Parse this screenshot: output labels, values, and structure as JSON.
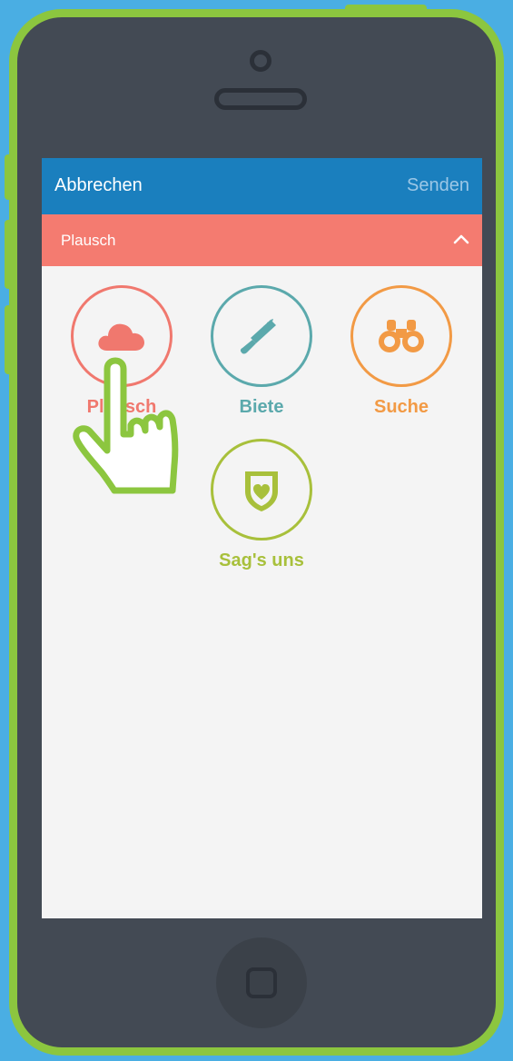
{
  "navbar": {
    "cancel_label": "Abbrechen",
    "send_label": "Senden"
  },
  "category_header": {
    "label": "Plausch",
    "chevron_icon": "chevron-up-icon"
  },
  "options": [
    {
      "label": "Plausch",
      "icon": "cloud-icon",
      "color": "#f0786e",
      "selected": true
    },
    {
      "label": "Biete",
      "icon": "saw-icon",
      "color": "#5ba9ac"
    },
    {
      "label": "Suche",
      "icon": "binoculars-icon",
      "color": "#f29a45"
    },
    {
      "label": "Sag's uns",
      "icon": "shield-heart-icon",
      "color": "#a8c03b"
    }
  ],
  "overlay": {
    "pointer_icon": "tap-hand-icon"
  },
  "colors": {
    "background": "#4aaee3",
    "phone_frame": "#8cc63f",
    "phone_body": "#434a54",
    "navbar": "#1a7fbe",
    "category_bar": "#f47b70",
    "screen": "#f4f4f4"
  }
}
